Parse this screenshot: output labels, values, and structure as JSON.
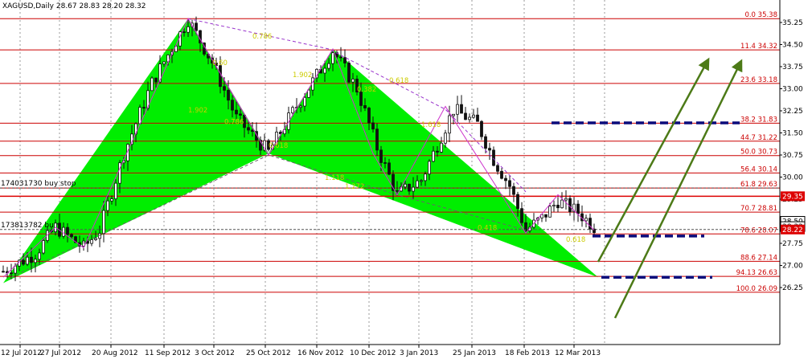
{
  "chart_title": "XAGUSD,Daily  28.67 28.83 28.20 28.32",
  "chart_data": {
    "type": "candlestick",
    "symbol": "XAGUSD",
    "timeframe": "Daily",
    "ohlc_header": {
      "open": 28.67,
      "high": 28.83,
      "low": 28.2,
      "close": 28.32
    },
    "ylim": [
      26.0,
      35.5
    ],
    "y_ticks": [
      "35.25",
      "34.50",
      "33.75",
      "33.00",
      "32.25",
      "31.50",
      "30.75",
      "30.00",
      "29.25",
      "28.50",
      "27.75",
      "27.00",
      "26.25"
    ],
    "x_ticks": [
      "12 Jul 2012",
      "27 Jul 2012",
      "20 Aug 2012",
      "11 Sep 2012",
      "3 Oct 2012",
      "25 Oct 2012",
      "16 Nov 2012",
      "10 Dec 2012",
      "3 Jan 2013",
      "25 Jan 2013",
      "18 Feb 2013",
      "12 Mar 2013"
    ],
    "fib_levels": [
      {
        "label": "0.0 35.38",
        "price": 35.38
      },
      {
        "label": "11.4 34.32",
        "price": 34.32
      },
      {
        "label": "23.6 33.18",
        "price": 33.18
      },
      {
        "label": "38.2 31.83",
        "price": 31.83
      },
      {
        "label": "44.7 31.22",
        "price": 31.22
      },
      {
        "label": "50.0 30.73",
        "price": 30.73
      },
      {
        "label": "56.4 30.14",
        "price": 30.14
      },
      {
        "label": "61.8 29.63",
        "price": 29.63
      },
      {
        "label": "70.7 28.81",
        "price": 28.81
      },
      {
        "label": "78.6 28.07",
        "price": 28.07
      },
      {
        "label": "88.6 27.14",
        "price": 27.14
      },
      {
        "label": "94.13 26.63",
        "price": 26.63
      },
      {
        "label": "100.0 26.09",
        "price": 26.09
      }
    ],
    "price_tags": [
      {
        "label": "29.35",
        "price": 29.35
      },
      {
        "label": "28.50",
        "price": 28.5
      },
      {
        "label": "28.32",
        "price": 28.32
      },
      {
        "label": "28.22",
        "price": 28.22
      }
    ],
    "order_labels": [
      {
        "label": "174031730 buy stop",
        "price": 29.63
      },
      {
        "label": "173813782 buy",
        "price": 28.22
      }
    ],
    "harmonic_ratios": [
      "0.786",
      "0.60",
      "1.902",
      "0.786",
      "0.618",
      "0.618",
      "0.382",
      "1.902",
      "1.118",
      "1.272",
      "0.418",
      "1.618",
      "0.618"
    ],
    "colors": {
      "pattern_fill": "#00ee00",
      "fib_line": "#cc0000",
      "candle": "#111111",
      "arrow": "#4c7a17",
      "target_dash": "#0a0a7a",
      "zigzag": "#cc33cc",
      "dotted_line": "#9933cc",
      "ratio_text": "#cccc00"
    }
  }
}
